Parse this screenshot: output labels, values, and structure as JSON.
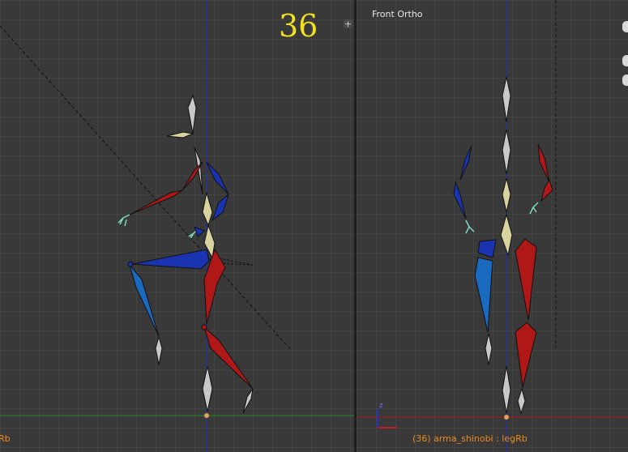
{
  "colors": {
    "viewport_bg": "#393939",
    "grid_line": "#444444",
    "bone_left_side": "#1a33b0",
    "bone_right_side": "#b01818",
    "bone_center": "#c8c8c8",
    "bone_selected": "#d8d4a0",
    "axis_x": "#c02020",
    "axis_y": "#20a020",
    "axis_z": "#2030c0",
    "frame_number": "#f0e020",
    "status_text": "#f08a1e"
  },
  "left_viewport": {
    "frame_number": "36",
    "status_text": "Rb"
  },
  "right_viewport": {
    "view_label": "Front Ortho",
    "status_text": "(36) arma_shinobi : legRb",
    "axis_gizmo": {
      "z_label": "z"
    }
  },
  "widgets": {
    "corner_add_icon": "+",
    "corner_add_icon_2": "+"
  }
}
